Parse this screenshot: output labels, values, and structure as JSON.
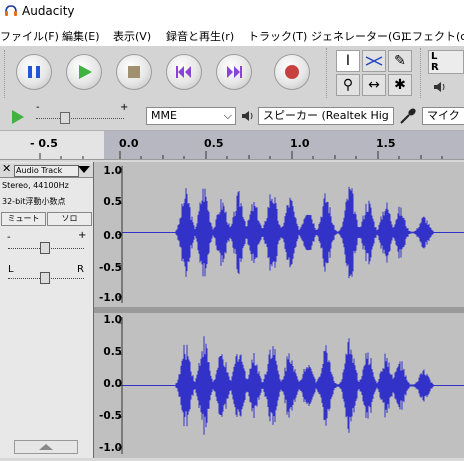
{
  "window": {
    "title": "Audacity"
  },
  "menu": [
    {
      "label": "ファイル(F)"
    },
    {
      "label": "編集(E)"
    },
    {
      "label": "表示(V)"
    },
    {
      "label": "録音と再生(r)"
    },
    {
      "label": "トラック(T)"
    },
    {
      "label": "ジェネレーター(G)"
    },
    {
      "label": "エフェクト(c)"
    }
  ],
  "meter": {
    "l": "L",
    "r": "R"
  },
  "device": {
    "host": "MME",
    "output": "スピーカー (Realtek Hig",
    "input": "マイク (R",
    "playback_slider_minus": "-",
    "playback_slider_plus": "+"
  },
  "ruler": {
    "ticks": [
      "- 0.5",
      "0.0",
      "0.5",
      "1.0",
      "1.5"
    ]
  },
  "track": {
    "name": "Audio Track",
    "format_line1": "Stereo, 44100Hz",
    "format_line2": "32-bit浮動小数点",
    "mute_label": "ミュート",
    "solo_label": "ソロ",
    "gain_minus": "-",
    "gain_plus": "+",
    "pan_left": "L",
    "pan_right": "R",
    "scale_top": [
      "1.0",
      "0.5",
      "0.0",
      "-0.5",
      "-1.0"
    ],
    "scale_bottom": [
      "1.0",
      "0.5",
      "0.0",
      "-0.5",
      "-1.0"
    ]
  },
  "colors": {
    "waveform": "#3232c8",
    "waveform_bg": "#c0c0c0",
    "ruler_active": "#b7b7c2",
    "record": "#c84141",
    "play": "#3fb23f",
    "pause": "#2454d8",
    "skip": "#8844d8"
  }
}
